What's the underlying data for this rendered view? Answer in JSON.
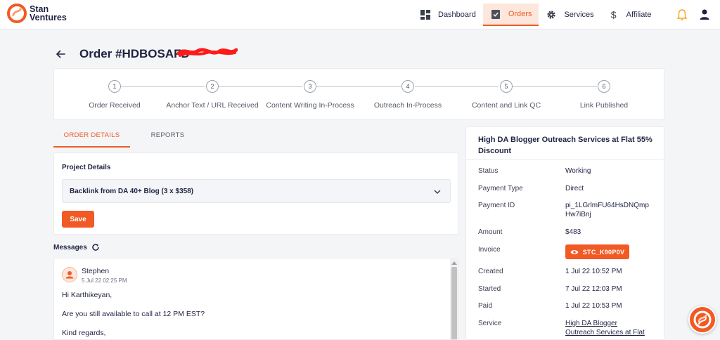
{
  "brand": {
    "line1": "Stan",
    "line2": "Ventures",
    "accent": "#f15a24"
  },
  "nav": {
    "items": [
      {
        "label": "Dashboard",
        "icon": "dashboard-icon"
      },
      {
        "label": "Orders",
        "icon": "clipboard-check-icon",
        "active": true
      },
      {
        "label": "Services",
        "icon": "gear-icon"
      },
      {
        "label": "Affiliate",
        "icon": "dollar-icon"
      }
    ],
    "bell_icon": "bell-icon",
    "user_icon": "user-icon"
  },
  "order": {
    "title": "Order #HDBOSAFD"
  },
  "steps": [
    {
      "number": "1",
      "label": "Order Received"
    },
    {
      "number": "2",
      "label": "Anchor Text / URL Received"
    },
    {
      "number": "3",
      "label": "Content Writing In-Process"
    },
    {
      "number": "4",
      "label": "Outreach In-Process"
    },
    {
      "number": "5",
      "label": "Content and Link QC"
    },
    {
      "number": "6",
      "label": "Link Published"
    }
  ],
  "tabs": [
    {
      "label": "ORDER DETAILS",
      "active": true
    },
    {
      "label": "REPORTS"
    }
  ],
  "project": {
    "label": "Project Details",
    "selected": "Backlink from DA 40+ Blog (3 x $358)",
    "save_label": "Save"
  },
  "messages": {
    "heading": "Messages",
    "author": "Stephen",
    "time": "5 Jul 22 02:25 PM",
    "lines": [
      "Hi Karthikeyan,",
      "Are you still available to call at 12 PM EST?",
      "Kind regards,"
    ]
  },
  "summary": {
    "title": "High DA Blogger Outreach Services at Flat 55% Discount",
    "rows": [
      {
        "label": "Status",
        "value": "Working"
      },
      {
        "label": "Payment Type",
        "value": "Direct"
      },
      {
        "label": "Payment ID",
        "value_line1": "pi_1LGrlmFU64HsDNQmp",
        "value_line2": "Hw7iBnj"
      },
      {
        "label": "Amount",
        "value": "$483"
      },
      {
        "label": "Invoice",
        "button": "STC_K90P0V"
      },
      {
        "label": "Created",
        "value": "1 Jul 22 10:52 PM"
      },
      {
        "label": "Started",
        "value": "7 Jul 22 12:03 PM"
      },
      {
        "label": "Paid",
        "value": "1 Jul 22 10:53 PM"
      },
      {
        "label": "Service",
        "value_line1": "High DA Blogger",
        "value_line2": "Outreach Services at Flat"
      }
    ]
  }
}
